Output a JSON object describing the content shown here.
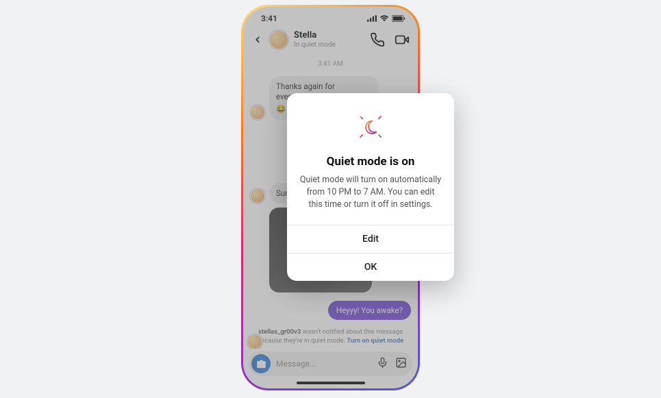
{
  "status_bar": {
    "time": "3:41"
  },
  "header": {
    "contact_name": "Stella",
    "contact_status": "In quiet mode"
  },
  "chat": {
    "timestamp": "3:41 AM",
    "msg1_text": "Thanks again for everything you",
    "msg1_emoji": "😂",
    "msg2_text": "Sure",
    "outgoing_text": "Heyyy! You awake?"
  },
  "notice": {
    "username": "stellas_gr00v3",
    "text": " wasn't notified about this message because they're in quiet mode. ",
    "link": "Turn on quiet mode"
  },
  "composer": {
    "placeholder": "Message..."
  },
  "modal": {
    "title": "Quiet mode is on",
    "body": "Quiet mode will turn on automatically from 10 PM to 7 AM. You can edit this time or turn it off in settings.",
    "edit_label": "Edit",
    "ok_label": "OK"
  }
}
